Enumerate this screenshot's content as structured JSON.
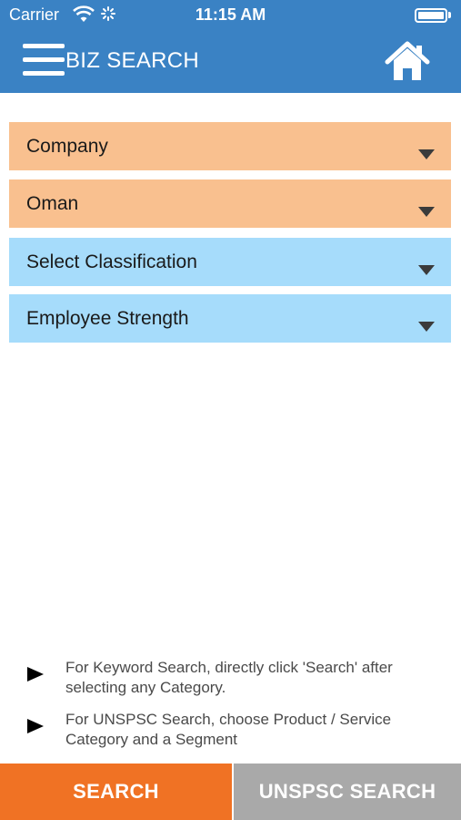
{
  "status_bar": {
    "carrier": "Carrier",
    "time": "11:15 AM",
    "battery_level": 1.0
  },
  "header": {
    "title": "BIZ SEARCH",
    "menu_icon": "hamburger-menu-icon",
    "home_icon": "home-icon",
    "color": "#3a82c4"
  },
  "filters": [
    {
      "label": "Company",
      "color": "#f9c08f"
    },
    {
      "label": "Oman",
      "color": "#f9c08f"
    },
    {
      "label": "Select Classification",
      "color": "#a6dcfb"
    },
    {
      "label": "Employee Strength",
      "color": "#a6dcfb"
    }
  ],
  "hints": [
    "For Keyword Search, directly click 'Search' after selecting any Category.",
    "For UNSPSC Search, choose Product / Service Category and a Segment"
  ],
  "actions": {
    "search_label": "SEARCH",
    "search_color": "#f07224",
    "unspsc_label": "UNSPSC SEARCH",
    "unspsc_color": "#a9a9a9"
  }
}
